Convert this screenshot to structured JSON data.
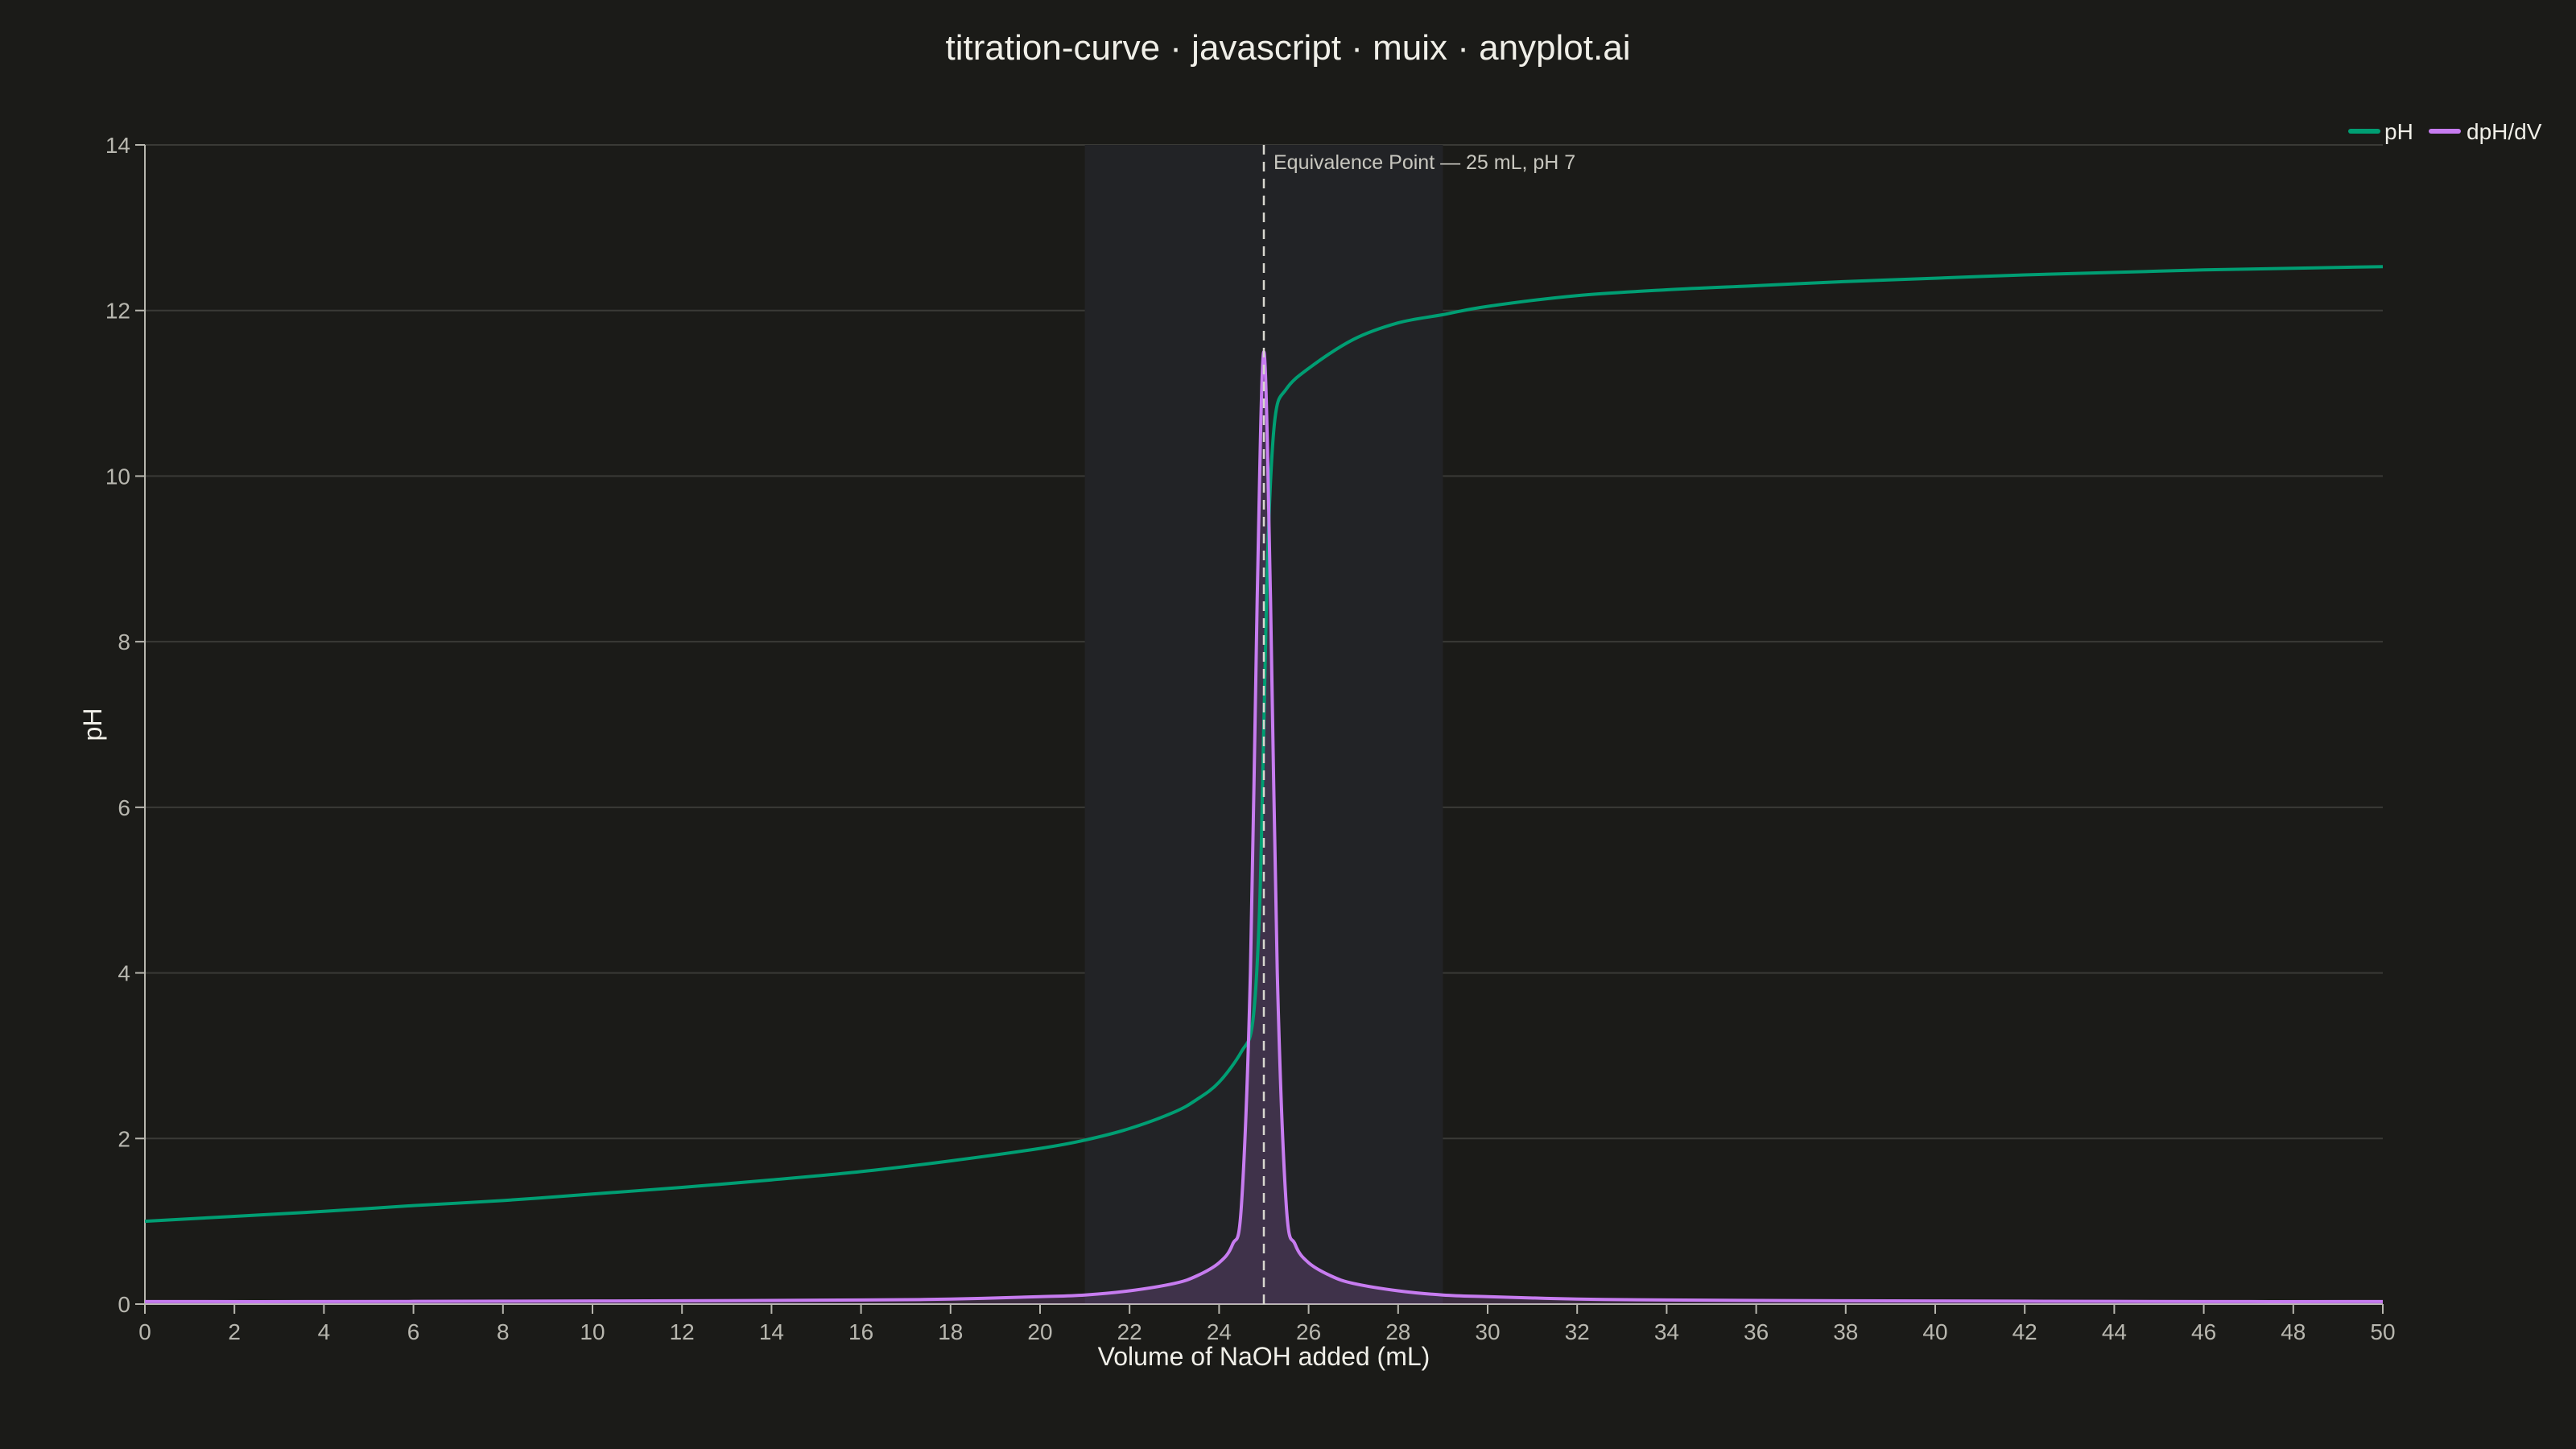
{
  "chart_data": {
    "type": "line",
    "title": "titration-curve · javascript · muix · anyplot.ai",
    "xlabel": "Volume of NaOH added (mL)",
    "ylabel": "pH",
    "xlim": [
      0,
      50
    ],
    "ylim": [
      0,
      14
    ],
    "x_ticks": [
      0,
      2,
      4,
      6,
      8,
      10,
      12,
      14,
      16,
      18,
      20,
      22,
      24,
      26,
      28,
      30,
      32,
      34,
      36,
      38,
      40,
      42,
      44,
      46,
      48,
      50
    ],
    "y_ticks": [
      0,
      2,
      4,
      6,
      8,
      10,
      12,
      14
    ],
    "grid": "horizontal",
    "legend_position": "top-right",
    "highlight_region": {
      "x_start": 21,
      "x_end": 29
    },
    "equivalence_line": {
      "x": 25,
      "label": "Equivalence Point — 25 mL, pH 7"
    },
    "series": [
      {
        "name": "pH",
        "color": "#009e73",
        "points": [
          [
            0,
            1.0
          ],
          [
            2,
            1.06
          ],
          [
            4,
            1.12
          ],
          [
            6,
            1.19
          ],
          [
            8,
            1.25
          ],
          [
            10,
            1.33
          ],
          [
            12,
            1.41
          ],
          [
            14,
            1.5
          ],
          [
            16,
            1.6
          ],
          [
            18,
            1.73
          ],
          [
            20,
            1.88
          ],
          [
            21,
            1.98
          ],
          [
            22,
            2.12
          ],
          [
            23,
            2.32
          ],
          [
            23.5,
            2.47
          ],
          [
            24,
            2.68
          ],
          [
            24.5,
            3.05
          ],
          [
            24.75,
            3.4
          ],
          [
            24.9,
            4.7
          ],
          [
            25,
            7.0
          ],
          [
            25.1,
            9.3
          ],
          [
            25.25,
            10.7
          ],
          [
            25.5,
            11.05
          ],
          [
            26,
            11.3
          ],
          [
            27,
            11.65
          ],
          [
            28,
            11.85
          ],
          [
            29,
            11.95
          ],
          [
            30,
            12.05
          ],
          [
            32,
            12.18
          ],
          [
            34,
            12.25
          ],
          [
            36,
            12.3
          ],
          [
            38,
            12.35
          ],
          [
            40,
            12.39
          ],
          [
            42,
            12.43
          ],
          [
            44,
            12.46
          ],
          [
            46,
            12.49
          ],
          [
            48,
            12.51
          ],
          [
            50,
            12.53
          ]
        ]
      },
      {
        "name": "dpH/dV",
        "color": "#c77cf0",
        "points": [
          [
            0,
            0.03
          ],
          [
            4,
            0.03
          ],
          [
            8,
            0.035
          ],
          [
            12,
            0.04
          ],
          [
            16,
            0.05
          ],
          [
            18,
            0.06
          ],
          [
            20,
            0.09
          ],
          [
            21,
            0.11
          ],
          [
            22,
            0.16
          ],
          [
            23,
            0.25
          ],
          [
            23.5,
            0.34
          ],
          [
            24,
            0.5
          ],
          [
            24.3,
            0.72
          ],
          [
            24.5,
            1.2
          ],
          [
            24.7,
            4.0
          ],
          [
            24.85,
            8.5
          ],
          [
            25,
            11.5
          ],
          [
            25.15,
            8.5
          ],
          [
            25.3,
            4.0
          ],
          [
            25.5,
            1.2
          ],
          [
            25.7,
            0.72
          ],
          [
            26,
            0.5
          ],
          [
            26.5,
            0.34
          ],
          [
            27,
            0.25
          ],
          [
            28,
            0.16
          ],
          [
            29,
            0.11
          ],
          [
            30,
            0.09
          ],
          [
            32,
            0.06
          ],
          [
            34,
            0.05
          ],
          [
            38,
            0.04
          ],
          [
            42,
            0.035
          ],
          [
            46,
            0.03
          ],
          [
            50,
            0.03
          ]
        ]
      }
    ]
  }
}
